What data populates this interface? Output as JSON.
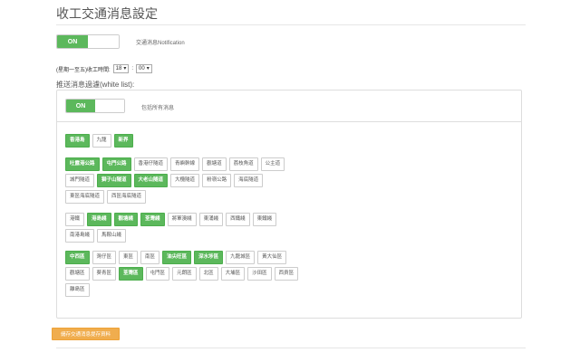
{
  "title": "收工交通消息設定",
  "notify": {
    "toggle": "ON",
    "label": "交通消息Notification"
  },
  "time": {
    "prefix": "(星期一至五)收工時間:",
    "hour": "18",
    "minute": "00"
  },
  "whitelist": {
    "title": "推送消息過濾(white list):",
    "toggle": "ON",
    "toggle_label": "包括所有消息",
    "group1": [
      {
        "label": "香港島",
        "on": true
      },
      {
        "label": "九龍",
        "on": false
      },
      {
        "label": "新界",
        "on": true
      }
    ],
    "group2": [
      {
        "label": "吐露港公路",
        "on": true
      },
      {
        "label": "屯門公路",
        "on": true
      },
      {
        "label": "香港仔隧道",
        "on": false
      },
      {
        "label": "青嶼幹線",
        "on": false
      },
      {
        "label": "觀塘道",
        "on": false
      },
      {
        "label": "荔枝角道",
        "on": false
      },
      {
        "label": "公主道",
        "on": false
      },
      {
        "label": "城門隧道",
        "on": false
      },
      {
        "label": "獅子山隧道",
        "on": true
      },
      {
        "label": "大老山隧道",
        "on": true
      },
      {
        "label": "大欖隧道",
        "on": false
      },
      {
        "label": "粉嶺公路",
        "on": false
      },
      {
        "label": "海底隧道",
        "on": false
      },
      {
        "label": "東區海底隧道",
        "on": false
      },
      {
        "label": "西區海底隧道",
        "on": false
      }
    ],
    "group3": [
      {
        "label": "港鐵",
        "on": false
      },
      {
        "label": "港島綫",
        "on": true
      },
      {
        "label": "觀塘綫",
        "on": true
      },
      {
        "label": "荃灣綫",
        "on": true
      },
      {
        "label": "將軍澳綫",
        "on": false
      },
      {
        "label": "東涌綫",
        "on": false
      },
      {
        "label": "西鐵綫",
        "on": false
      },
      {
        "label": "東鐵綫",
        "on": false
      },
      {
        "label": "南港島綫",
        "on": false
      },
      {
        "label": "馬鞍山綫",
        "on": false
      }
    ],
    "group4": [
      {
        "label": "中西區",
        "on": true
      },
      {
        "label": "灣仔區",
        "on": false
      },
      {
        "label": "東區",
        "on": false
      },
      {
        "label": "南區",
        "on": false
      },
      {
        "label": "油尖旺區",
        "on": true
      },
      {
        "label": "深水埗區",
        "on": true
      },
      {
        "label": "九龍城區",
        "on": false
      },
      {
        "label": "黃大仙區",
        "on": false
      },
      {
        "label": "觀塘區",
        "on": false
      },
      {
        "label": "葵青區",
        "on": false
      },
      {
        "label": "荃灣區",
        "on": true
      },
      {
        "label": "屯門區",
        "on": false
      },
      {
        "label": "元朗區",
        "on": false
      },
      {
        "label": "北區",
        "on": false
      },
      {
        "label": "大埔區",
        "on": false
      },
      {
        "label": "沙田區",
        "on": false
      },
      {
        "label": "西貢區",
        "on": false
      },
      {
        "label": "離島區",
        "on": false
      }
    ]
  },
  "save_label": "儲存交通消息提存資料",
  "colors": {
    "green": "#5cb85c",
    "orange": "#f0ad4e"
  }
}
